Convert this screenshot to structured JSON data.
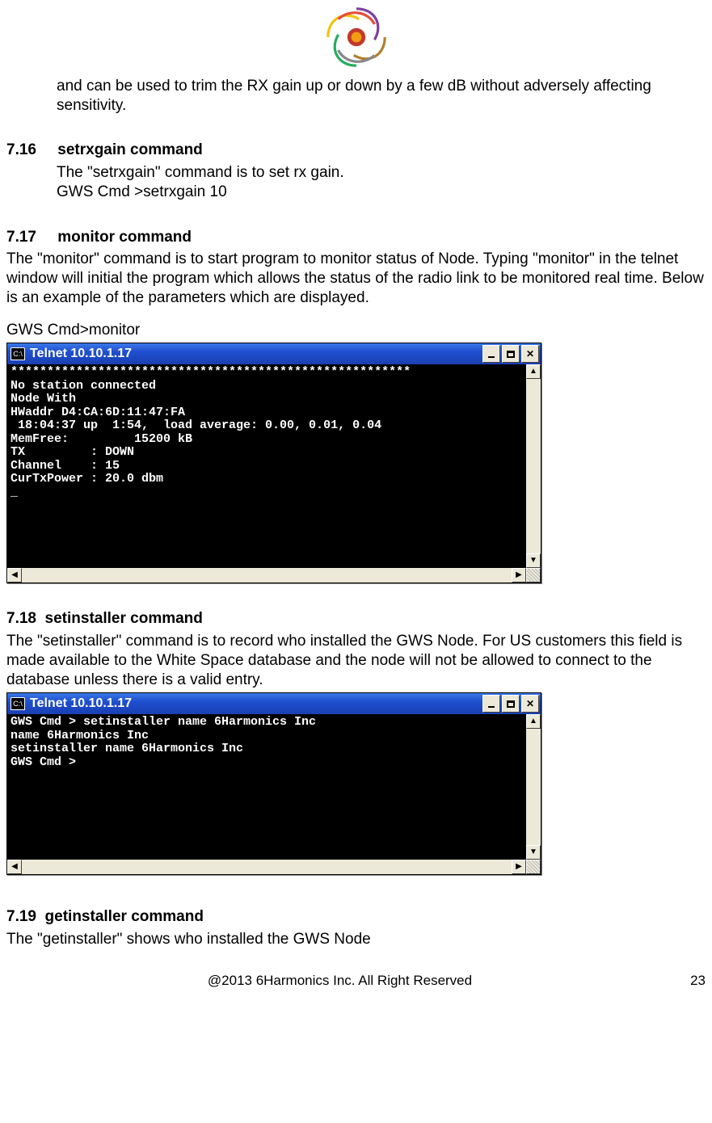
{
  "continued_text": "and can be used to trim the RX gain up or down by a few dB without adversely affecting sensitivity.",
  "sections": {
    "s716": {
      "num": "7.16",
      "title": "setrxgain command",
      "body": "The \"setrxgain\" command is to set rx gain.",
      "cmd": "GWS Cmd >setrxgain 10"
    },
    "s717": {
      "num": "7.17",
      "title": "monitor command",
      "body": "The \"monitor\" command is to start program to monitor status of Node.   Typing \"monitor\" in the telnet window will initial the program which allows the status of the radio link to be monitored real time.  Below is an example of the parameters which are displayed.",
      "cmd": "GWS Cmd>monitor"
    },
    "s718": {
      "num": "7.18",
      "title": "setinstaller  command",
      "body": "The \"setinstaller\" command is to record who installed the GWS Node.  For US customers this field is made available to the  White Space database and the node will not be allowed to connect to the database unless there is a valid entry."
    },
    "s719": {
      "num": "7.19",
      "title": "getinstaller command",
      "body": "The \"getinstaller\" shows who installed the GWS Node"
    }
  },
  "telnet": {
    "title": "Telnet 10.10.1.17",
    "icon_label": "C:\\",
    "monitor_output": "*******************************************************\nNo station connected\nNode With\nHWaddr D4:CA:6D:11:47:FA\n 18:04:37 up  1:54,  load average: 0.00, 0.01, 0.04\nMemFree:         15200 kB\nTX         : DOWN\nChannel    : 15\nCurTxPower : 20.0 dbm\n_",
    "setinstaller_output": "GWS Cmd > setinstaller name 6Harmonics Inc\nname 6Harmonics Inc\nsetinstaller name 6Harmonics Inc\nGWS Cmd >"
  },
  "footer": {
    "copyright": "@2013 6Harmonics Inc. All Right Reserved",
    "page": "23"
  }
}
